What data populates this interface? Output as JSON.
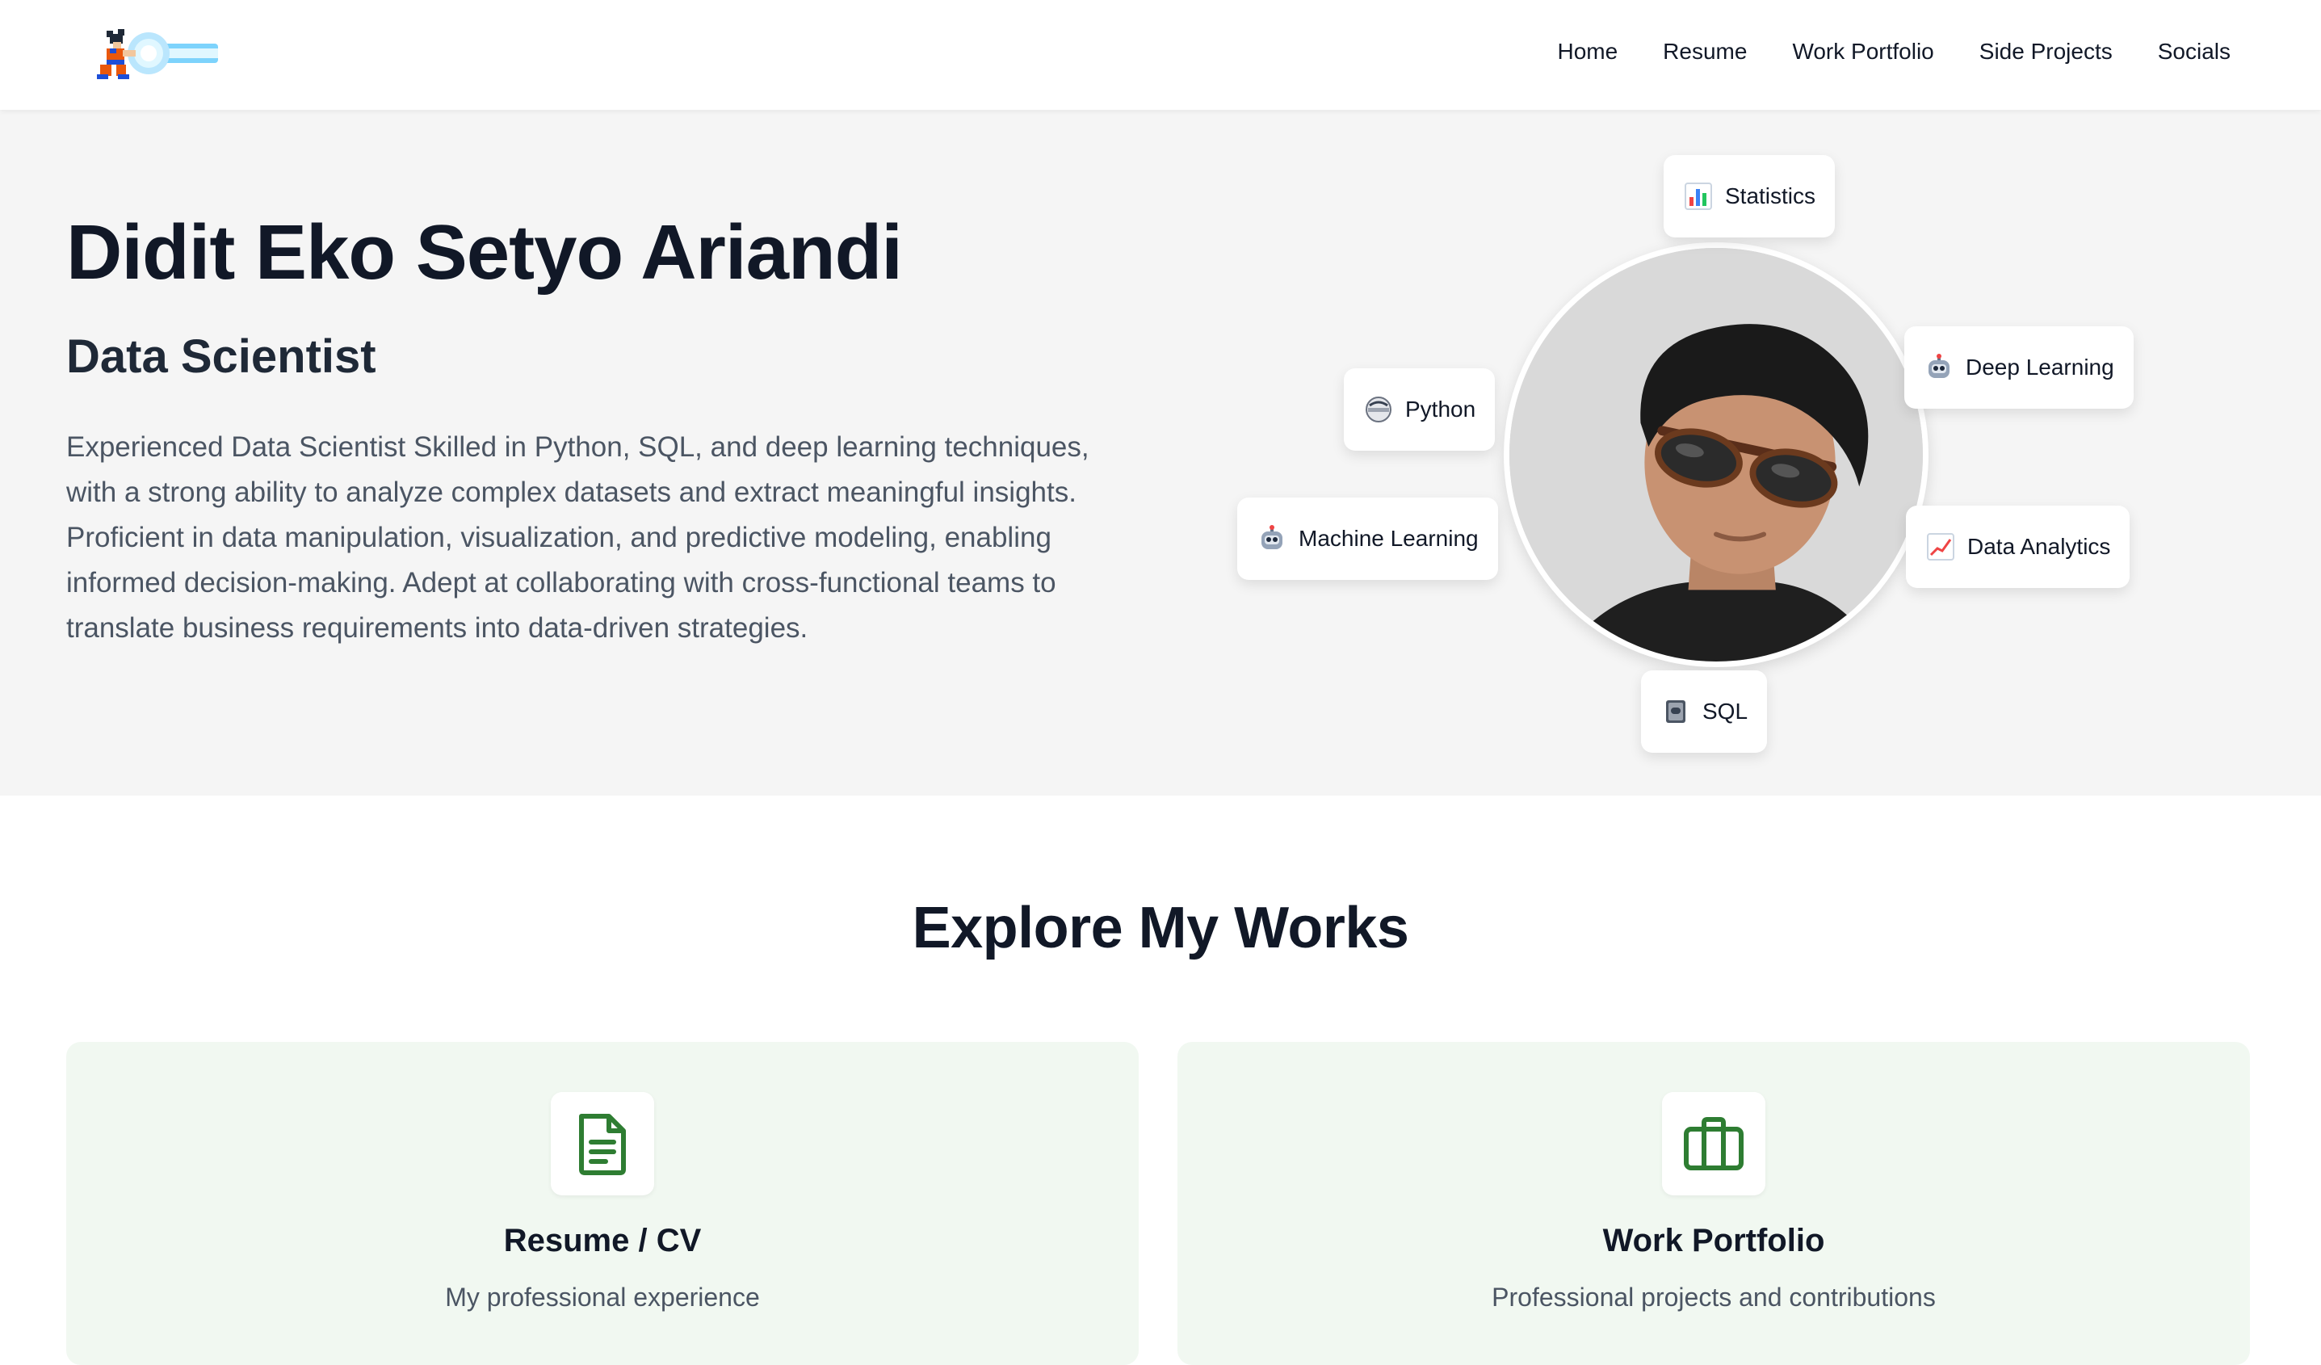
{
  "nav": {
    "links": [
      "Home",
      "Resume",
      "Work Portfolio",
      "Side Projects",
      "Socials"
    ]
  },
  "hero": {
    "name": "Didit Eko Setyo Ariandi",
    "role": "Data Scientist",
    "description": "Experienced Data Scientist Skilled in Python, SQL, and deep learning techniques, with a strong ability to analyze complex datasets and extract meaningful insights. Proficient in data manipulation, visualization, and predictive modeling, enabling informed decision-making. Adept at collaborating with cross-functional teams to translate business requirements into data-driven strategies."
  },
  "skills": {
    "statistics": {
      "label": "Statistics",
      "icon": "bar-chart-icon"
    },
    "deep_learning": {
      "label": "Deep Learning",
      "icon": "robot-icon"
    },
    "python": {
      "label": "Python",
      "icon": "python-icon"
    },
    "machine_learning": {
      "label": "Machine Learning",
      "icon": "robot-icon"
    },
    "data_analytics": {
      "label": "Data Analytics",
      "icon": "trend-chart-icon"
    },
    "sql": {
      "label": "SQL",
      "icon": "database-book-icon"
    }
  },
  "explore": {
    "title": "Explore My Works",
    "cards": [
      {
        "title": "Resume / CV",
        "subtitle": "My professional experience",
        "icon": "document-icon"
      },
      {
        "title": "Work Portfolio",
        "subtitle": "Professional projects and contributions",
        "icon": "briefcase-icon"
      }
    ]
  },
  "colors": {
    "accent_green": "#2e7d32",
    "card_bg": "#f1f8f1",
    "hero_bg": "#f5f5f5"
  }
}
